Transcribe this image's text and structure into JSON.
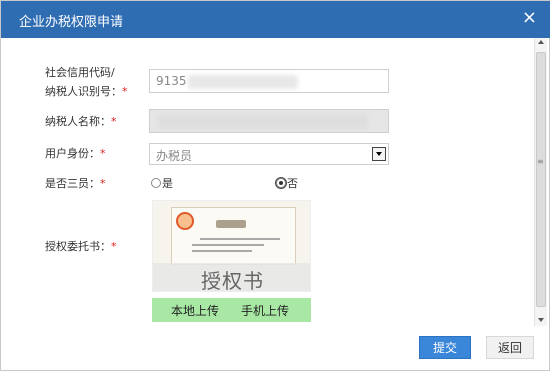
{
  "dialog": {
    "title": "企业办税权限申请",
    "close_icon": "×"
  },
  "form": {
    "credit_code_label_line1": "社会信用代码/",
    "credit_code_label_line2": "纳税人识别号：",
    "credit_code_value": "9135",
    "taxpayer_name_label": "纳税人名称：",
    "taxpayer_name_value": "",
    "identity_label": "用户身份：",
    "identity_value": "办税员",
    "three_member_label": "是否三员：",
    "radio_yes": "是",
    "radio_no": "否",
    "radio_selected": "否",
    "auth_letter_label": "授权委托书：",
    "auth_letter_preview_text": "授权书",
    "auth_letter_heading": "授权书",
    "upload_local": "本地上传",
    "upload_mobile": "手机上传",
    "required_mark": "*"
  },
  "actions": {
    "submit": "提交",
    "back": "返回"
  },
  "colors": {
    "titlebar": "#2f6db3",
    "primary_button": "#3a86d8",
    "upload_bar": "#a8e8a4",
    "required": "#e02020"
  },
  "icons": {
    "close": "close-icon",
    "select_arrow": "chevron-down-icon"
  }
}
